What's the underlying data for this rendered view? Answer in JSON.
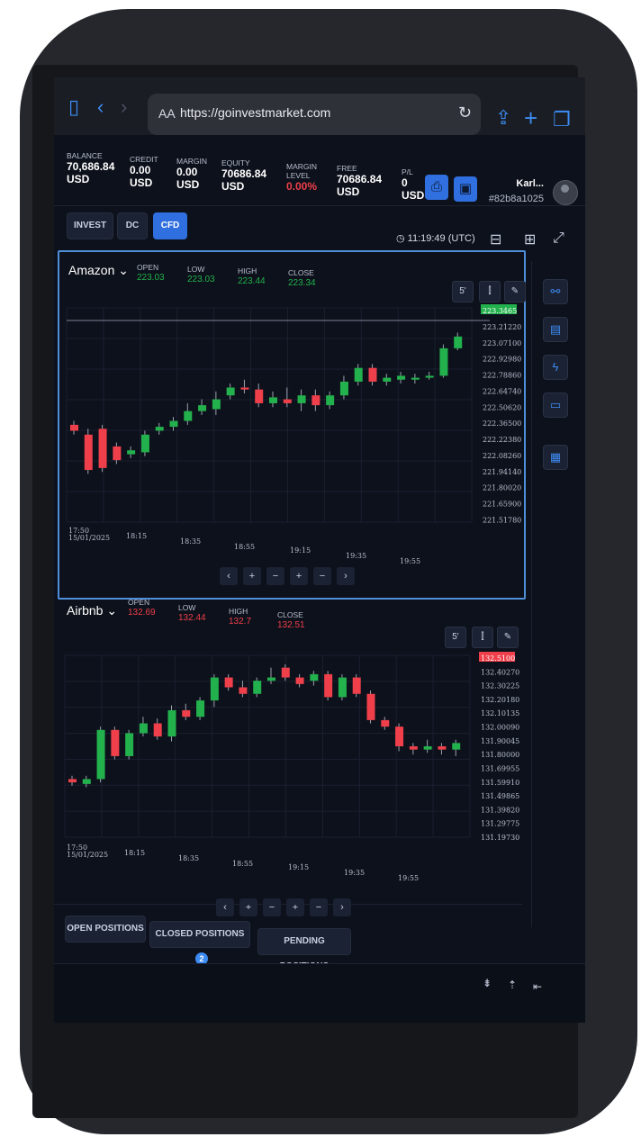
{
  "browser": {
    "url": "https://goinvestmarket.com",
    "aa_label": "AA"
  },
  "account": {
    "stats": [
      {
        "label": "BALANCE",
        "value": "70,686.84 USD"
      },
      {
        "label": "CREDIT",
        "value": "0.00 USD"
      },
      {
        "label": "MARGIN",
        "value": "0.00 USD"
      },
      {
        "label": "EQUITY",
        "value": "70686.84 USD"
      },
      {
        "label": "MARGIN LEVEL",
        "value": "0.00%"
      },
      {
        "label": "FREE",
        "value": "70686.84 USD"
      },
      {
        "label": "P/L",
        "value": "0 USD"
      }
    ],
    "user_name": "Karl...",
    "user_id": "#82b8a1025"
  },
  "mode_tabs": [
    "INVEST",
    "DC",
    "CFD"
  ],
  "active_mode": "CFD",
  "clock": "11:19:49 (UTC)",
  "charts": [
    {
      "symbol": "Amazon",
      "open": "223.03",
      "low": "223.03",
      "high": "223.44",
      "close": "223.34",
      "value_color": "#22b14c",
      "interval": "5'",
      "price_labels": [
        "223.3465",
        "223.21220",
        "223.07100",
        "222.92980",
        "222.78860",
        "222.64740",
        "222.50620",
        "222.36500",
        "222.22380",
        "222.08260",
        "221.94140",
        "221.80020",
        "221.65900",
        "221.51780"
      ],
      "time_labels": [
        "17:50",
        "15/01/2025",
        "18:15",
        "18:35",
        "18:55",
        "19:15",
        "19:35",
        "19:55"
      ]
    },
    {
      "symbol": "Airbnb",
      "open": "132.69",
      "low": "132.44",
      "high": "132.7",
      "close": "132.51",
      "value_color": "#ef3f4a",
      "interval": "5'",
      "price_labels": [
        "132.5100",
        "132.40270",
        "132.30225",
        "132.20180",
        "132.10135",
        "132.00090",
        "131.90045",
        "131.80000",
        "131.69955",
        "131.59910",
        "131.49865",
        "131.39820",
        "131.29775",
        "131.19730"
      ],
      "time_labels": [
        "17:50",
        "15/01/2025",
        "18:15",
        "18:35",
        "18:55",
        "19:15",
        "19:35",
        "19:55"
      ]
    }
  ],
  "zoom_controls": [
    "‹",
    "+",
    "−",
    "+",
    "−",
    "›"
  ],
  "bottom_tabs": [
    {
      "label": "OPEN POSITIONS"
    },
    {
      "label": "CLOSED POSITIONS",
      "badge": "2"
    },
    {
      "label": "PENDING POSITIONS"
    }
  ],
  "colors": {
    "accent": "#2f6fdf",
    "up": "#22b14c",
    "down": "#ef3f4a",
    "background": "#0d111b"
  }
}
